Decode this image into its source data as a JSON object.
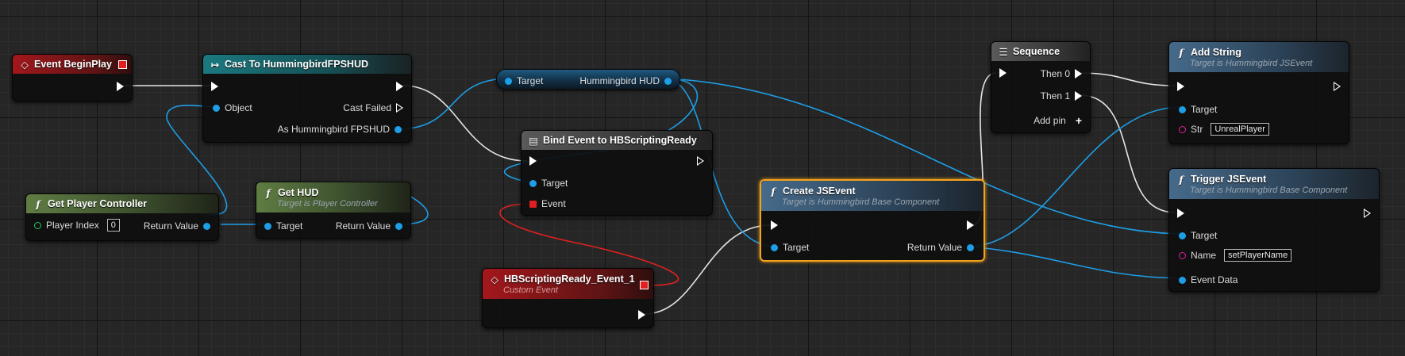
{
  "nodes": {
    "event_beginplay": {
      "title": "Event BeginPlay"
    },
    "cast": {
      "title": "Cast To HummingbirdFPSHUD",
      "object": "Object",
      "cast_failed": "Cast Failed",
      "as_hud": "As Hummingbird FPSHUD"
    },
    "get_player_controller": {
      "title": "Get Player Controller",
      "player_index": "Player Index",
      "player_index_value": "0",
      "return_value": "Return Value"
    },
    "get_hud": {
      "title": "Get HUD",
      "subtitle": "Target is Player Controller",
      "target": "Target",
      "return_value": "Return Value"
    },
    "hud_var": {
      "target": "Target",
      "hud": "Hummingbird HUD"
    },
    "bind_event": {
      "title": "Bind Event to HBScriptingReady",
      "target": "Target",
      "event": "Event"
    },
    "custom_event": {
      "title": "HBScriptingReady_Event_1",
      "subtitle": "Custom Event"
    },
    "create_jsevent": {
      "title": "Create JSEvent",
      "subtitle": "Target is Hummingbird Base Component",
      "target": "Target",
      "return_value": "Return Value"
    },
    "sequence": {
      "title": "Sequence",
      "then0": "Then 0",
      "then1": "Then 1",
      "add_pin": "Add pin"
    },
    "add_string": {
      "title": "Add String",
      "subtitle": "Target is Hummingbird JSEvent",
      "target": "Target",
      "str": "Str",
      "str_value": "UnrealPlayer"
    },
    "trigger_jsevent": {
      "title": "Trigger JSEvent",
      "subtitle": "Target is Hummingbird Base Component",
      "target": "Target",
      "name": "Name",
      "name_value": "setPlayerName",
      "event_data": "Event Data"
    }
  },
  "colors": {
    "exec_wire": "#e6e6e6",
    "object_wire": "#1d9ee6",
    "delegate_wire": "#e02020",
    "selection": "#f4a21b"
  },
  "icons": {
    "function": "function-icon",
    "event": "event-diamond-icon",
    "cast": "cast-arrow-icon",
    "sequence": "sequence-icon",
    "bind": "bind-event-icon"
  }
}
